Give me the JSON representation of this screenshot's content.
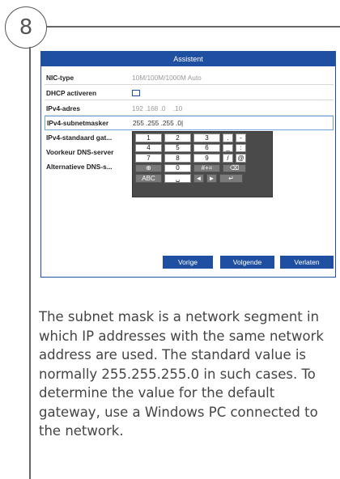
{
  "step_number": "8",
  "window": {
    "title": "Assistent"
  },
  "form": {
    "nic_type": {
      "label": "NIC-type",
      "value": "10M/100M/1000M Auto"
    },
    "dhcp": {
      "label": "DHCP activeren",
      "checked": false
    },
    "ipv4_address": {
      "label": "IPv4-adres",
      "value": "192 .168 .0    .10"
    },
    "ipv4_subnet": {
      "label": "IPv4-subnetmasker",
      "value": "255 .255 .255 .0|"
    },
    "ipv4_gateway": {
      "label": "IPv4-standaard gat..."
    },
    "dns_pref": {
      "label": "Voorkeur DNS-server"
    },
    "dns_alt": {
      "label": "Alternatieve DNS-s..."
    }
  },
  "keyboard": {
    "row1": [
      "1",
      "2",
      "3",
      ".",
      "-"
    ],
    "row2": [
      "4",
      "5",
      "6",
      "_",
      ":"
    ],
    "row3": [
      "7",
      "8",
      "9",
      "/",
      "@"
    ],
    "row4": {
      "globe": "⊕",
      "zero": "0",
      "symbols": "#+=",
      "backspace": "⌫"
    },
    "row5": {
      "abc": "ABC",
      "space": "␣",
      "left": "◄",
      "right": "►",
      "enter": "↵"
    }
  },
  "buttons": {
    "previous": "Vorige",
    "next": "Volgende",
    "cancel": "Verlaten"
  },
  "description": "The subnet mask is a network segment in which IP addresses with the same network address are used. The standard value is normally 255.255.255.0 in such cases. To determine the value for the default gateway, use a Windows PC connected to the network."
}
